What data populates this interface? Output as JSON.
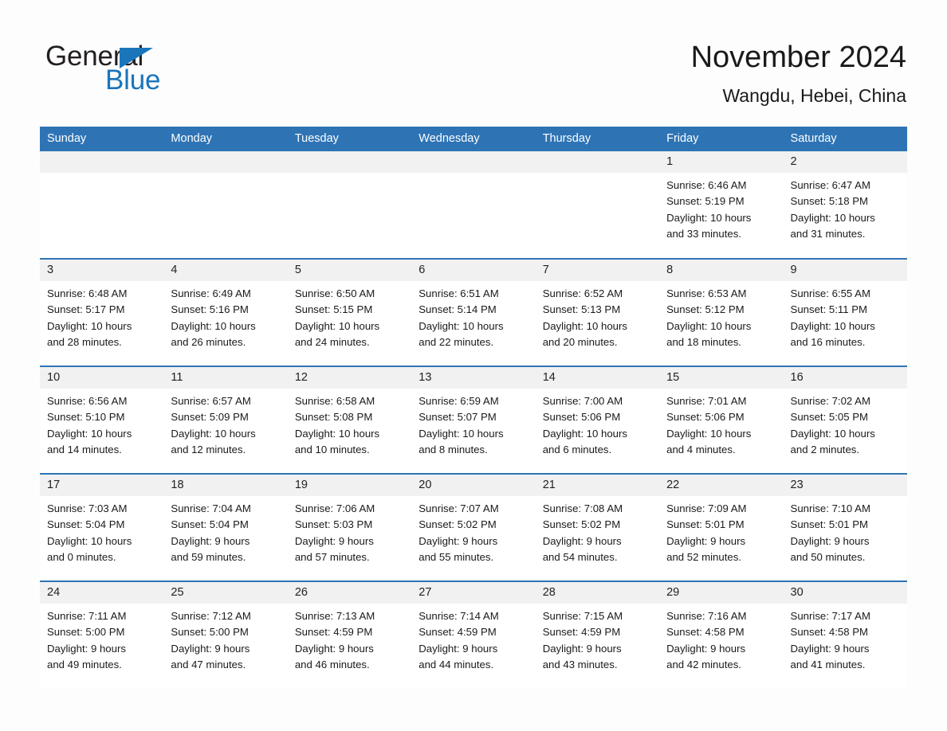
{
  "brand": {
    "word_one": "General",
    "word_two": "Blue",
    "triangle_icon": "triangle-icon",
    "color_blue": "#1b75bb"
  },
  "header": {
    "title": "November 2024",
    "subtitle": "Wangdu, Hebei, China"
  },
  "theme": {
    "header_blue": "#2e74b5",
    "row_divider_blue": "#2e74b5",
    "daynum_band": "#f1f1f1",
    "page_background": "#fdfdfd",
    "text": "#1a1a1a"
  },
  "calendar": {
    "weekday_headers": [
      "Sunday",
      "Monday",
      "Tuesday",
      "Wednesday",
      "Thursday",
      "Friday",
      "Saturday"
    ],
    "weeks": [
      [
        {
          "day": "",
          "empty": true
        },
        {
          "day": "",
          "empty": true
        },
        {
          "day": "",
          "empty": true
        },
        {
          "day": "",
          "empty": true
        },
        {
          "day": "",
          "empty": true
        },
        {
          "day": "1",
          "sunrise": "Sunrise: 6:46 AM",
          "sunset": "Sunset: 5:19 PM",
          "daylight_line1": "Daylight: 10 hours",
          "daylight_line2": "and 33 minutes."
        },
        {
          "day": "2",
          "sunrise": "Sunrise: 6:47 AM",
          "sunset": "Sunset: 5:18 PM",
          "daylight_line1": "Daylight: 10 hours",
          "daylight_line2": "and 31 minutes."
        }
      ],
      [
        {
          "day": "3",
          "sunrise": "Sunrise: 6:48 AM",
          "sunset": "Sunset: 5:17 PM",
          "daylight_line1": "Daylight: 10 hours",
          "daylight_line2": "and 28 minutes."
        },
        {
          "day": "4",
          "sunrise": "Sunrise: 6:49 AM",
          "sunset": "Sunset: 5:16 PM",
          "daylight_line1": "Daylight: 10 hours",
          "daylight_line2": "and 26 minutes."
        },
        {
          "day": "5",
          "sunrise": "Sunrise: 6:50 AM",
          "sunset": "Sunset: 5:15 PM",
          "daylight_line1": "Daylight: 10 hours",
          "daylight_line2": "and 24 minutes."
        },
        {
          "day": "6",
          "sunrise": "Sunrise: 6:51 AM",
          "sunset": "Sunset: 5:14 PM",
          "daylight_line1": "Daylight: 10 hours",
          "daylight_line2": "and 22 minutes."
        },
        {
          "day": "7",
          "sunrise": "Sunrise: 6:52 AM",
          "sunset": "Sunset: 5:13 PM",
          "daylight_line1": "Daylight: 10 hours",
          "daylight_line2": "and 20 minutes."
        },
        {
          "day": "8",
          "sunrise": "Sunrise: 6:53 AM",
          "sunset": "Sunset: 5:12 PM",
          "daylight_line1": "Daylight: 10 hours",
          "daylight_line2": "and 18 minutes."
        },
        {
          "day": "9",
          "sunrise": "Sunrise: 6:55 AM",
          "sunset": "Sunset: 5:11 PM",
          "daylight_line1": "Daylight: 10 hours",
          "daylight_line2": "and 16 minutes."
        }
      ],
      [
        {
          "day": "10",
          "sunrise": "Sunrise: 6:56 AM",
          "sunset": "Sunset: 5:10 PM",
          "daylight_line1": "Daylight: 10 hours",
          "daylight_line2": "and 14 minutes."
        },
        {
          "day": "11",
          "sunrise": "Sunrise: 6:57 AM",
          "sunset": "Sunset: 5:09 PM",
          "daylight_line1": "Daylight: 10 hours",
          "daylight_line2": "and 12 minutes."
        },
        {
          "day": "12",
          "sunrise": "Sunrise: 6:58 AM",
          "sunset": "Sunset: 5:08 PM",
          "daylight_line1": "Daylight: 10 hours",
          "daylight_line2": "and 10 minutes."
        },
        {
          "day": "13",
          "sunrise": "Sunrise: 6:59 AM",
          "sunset": "Sunset: 5:07 PM",
          "daylight_line1": "Daylight: 10 hours",
          "daylight_line2": "and 8 minutes."
        },
        {
          "day": "14",
          "sunrise": "Sunrise: 7:00 AM",
          "sunset": "Sunset: 5:06 PM",
          "daylight_line1": "Daylight: 10 hours",
          "daylight_line2": "and 6 minutes."
        },
        {
          "day": "15",
          "sunrise": "Sunrise: 7:01 AM",
          "sunset": "Sunset: 5:06 PM",
          "daylight_line1": "Daylight: 10 hours",
          "daylight_line2": "and 4 minutes."
        },
        {
          "day": "16",
          "sunrise": "Sunrise: 7:02 AM",
          "sunset": "Sunset: 5:05 PM",
          "daylight_line1": "Daylight: 10 hours",
          "daylight_line2": "and 2 minutes."
        }
      ],
      [
        {
          "day": "17",
          "sunrise": "Sunrise: 7:03 AM",
          "sunset": "Sunset: 5:04 PM",
          "daylight_line1": "Daylight: 10 hours",
          "daylight_line2": "and 0 minutes."
        },
        {
          "day": "18",
          "sunrise": "Sunrise: 7:04 AM",
          "sunset": "Sunset: 5:04 PM",
          "daylight_line1": "Daylight: 9 hours",
          "daylight_line2": "and 59 minutes."
        },
        {
          "day": "19",
          "sunrise": "Sunrise: 7:06 AM",
          "sunset": "Sunset: 5:03 PM",
          "daylight_line1": "Daylight: 9 hours",
          "daylight_line2": "and 57 minutes."
        },
        {
          "day": "20",
          "sunrise": "Sunrise: 7:07 AM",
          "sunset": "Sunset: 5:02 PM",
          "daylight_line1": "Daylight: 9 hours",
          "daylight_line2": "and 55 minutes."
        },
        {
          "day": "21",
          "sunrise": "Sunrise: 7:08 AM",
          "sunset": "Sunset: 5:02 PM",
          "daylight_line1": "Daylight: 9 hours",
          "daylight_line2": "and 54 minutes."
        },
        {
          "day": "22",
          "sunrise": "Sunrise: 7:09 AM",
          "sunset": "Sunset: 5:01 PM",
          "daylight_line1": "Daylight: 9 hours",
          "daylight_line2": "and 52 minutes."
        },
        {
          "day": "23",
          "sunrise": "Sunrise: 7:10 AM",
          "sunset": "Sunset: 5:01 PM",
          "daylight_line1": "Daylight: 9 hours",
          "daylight_line2": "and 50 minutes."
        }
      ],
      [
        {
          "day": "24",
          "sunrise": "Sunrise: 7:11 AM",
          "sunset": "Sunset: 5:00 PM",
          "daylight_line1": "Daylight: 9 hours",
          "daylight_line2": "and 49 minutes."
        },
        {
          "day": "25",
          "sunrise": "Sunrise: 7:12 AM",
          "sunset": "Sunset: 5:00 PM",
          "daylight_line1": "Daylight: 9 hours",
          "daylight_line2": "and 47 minutes."
        },
        {
          "day": "26",
          "sunrise": "Sunrise: 7:13 AM",
          "sunset": "Sunset: 4:59 PM",
          "daylight_line1": "Daylight: 9 hours",
          "daylight_line2": "and 46 minutes."
        },
        {
          "day": "27",
          "sunrise": "Sunrise: 7:14 AM",
          "sunset": "Sunset: 4:59 PM",
          "daylight_line1": "Daylight: 9 hours",
          "daylight_line2": "and 44 minutes."
        },
        {
          "day": "28",
          "sunrise": "Sunrise: 7:15 AM",
          "sunset": "Sunset: 4:59 PM",
          "daylight_line1": "Daylight: 9 hours",
          "daylight_line2": "and 43 minutes."
        },
        {
          "day": "29",
          "sunrise": "Sunrise: 7:16 AM",
          "sunset": "Sunset: 4:58 PM",
          "daylight_line1": "Daylight: 9 hours",
          "daylight_line2": "and 42 minutes."
        },
        {
          "day": "30",
          "sunrise": "Sunrise: 7:17 AM",
          "sunset": "Sunset: 4:58 PM",
          "daylight_line1": "Daylight: 9 hours",
          "daylight_line2": "and 41 minutes."
        }
      ]
    ]
  }
}
